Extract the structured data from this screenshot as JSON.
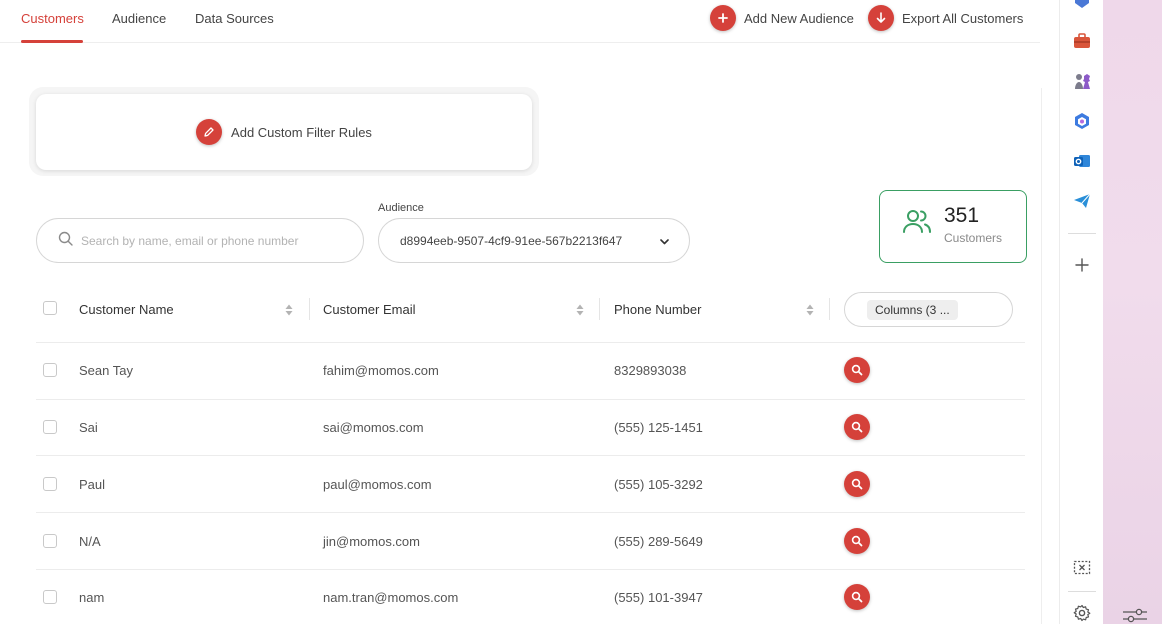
{
  "nav": {
    "tabs": [
      {
        "label": "Customers",
        "active": true
      },
      {
        "label": "Audience",
        "active": false
      },
      {
        "label": "Data Sources",
        "active": false
      }
    ],
    "add_audience_label": "Add New Audience",
    "export_label": "Export All Customers"
  },
  "filter": {
    "label": "Add Custom Filter Rules"
  },
  "search": {
    "placeholder": "Search by name, email or phone number",
    "value": ""
  },
  "audience": {
    "label": "Audience",
    "selected": "d8994eeb-9507-4cf9-91ee-567b2213f647"
  },
  "summary": {
    "count": "351",
    "label": "Customers"
  },
  "table": {
    "headers": {
      "name": "Customer Name",
      "email": "Customer Email",
      "phone": "Phone Number",
      "columns_button": "Columns (3 ..."
    },
    "rows": [
      {
        "name": "Sean Tay",
        "email": "fahim@momos.com",
        "phone": "8329893038"
      },
      {
        "name": "Sai",
        "email": "sai@momos.com",
        "phone": "(555) 125-1451"
      },
      {
        "name": "Paul",
        "email": "paul@momos.com",
        "phone": "(555) 105-3292"
      },
      {
        "name": "N/A",
        "email": "jin@momos.com",
        "phone": "(555) 289-5649"
      },
      {
        "name": "nam",
        "email": "nam.tran@momos.com",
        "phone": "(555) 101-3947"
      }
    ]
  },
  "rail": {
    "icons": [
      "bookmark-icon",
      "briefcase-icon",
      "chess-icon",
      "copilot-icon",
      "outlook-icon",
      "send-icon",
      "plus-icon",
      "screenshot-icon",
      "settings-icon"
    ]
  },
  "colors": {
    "accent": "#d5413a",
    "success": "#3a9f63",
    "border": "#d6d6d6"
  }
}
